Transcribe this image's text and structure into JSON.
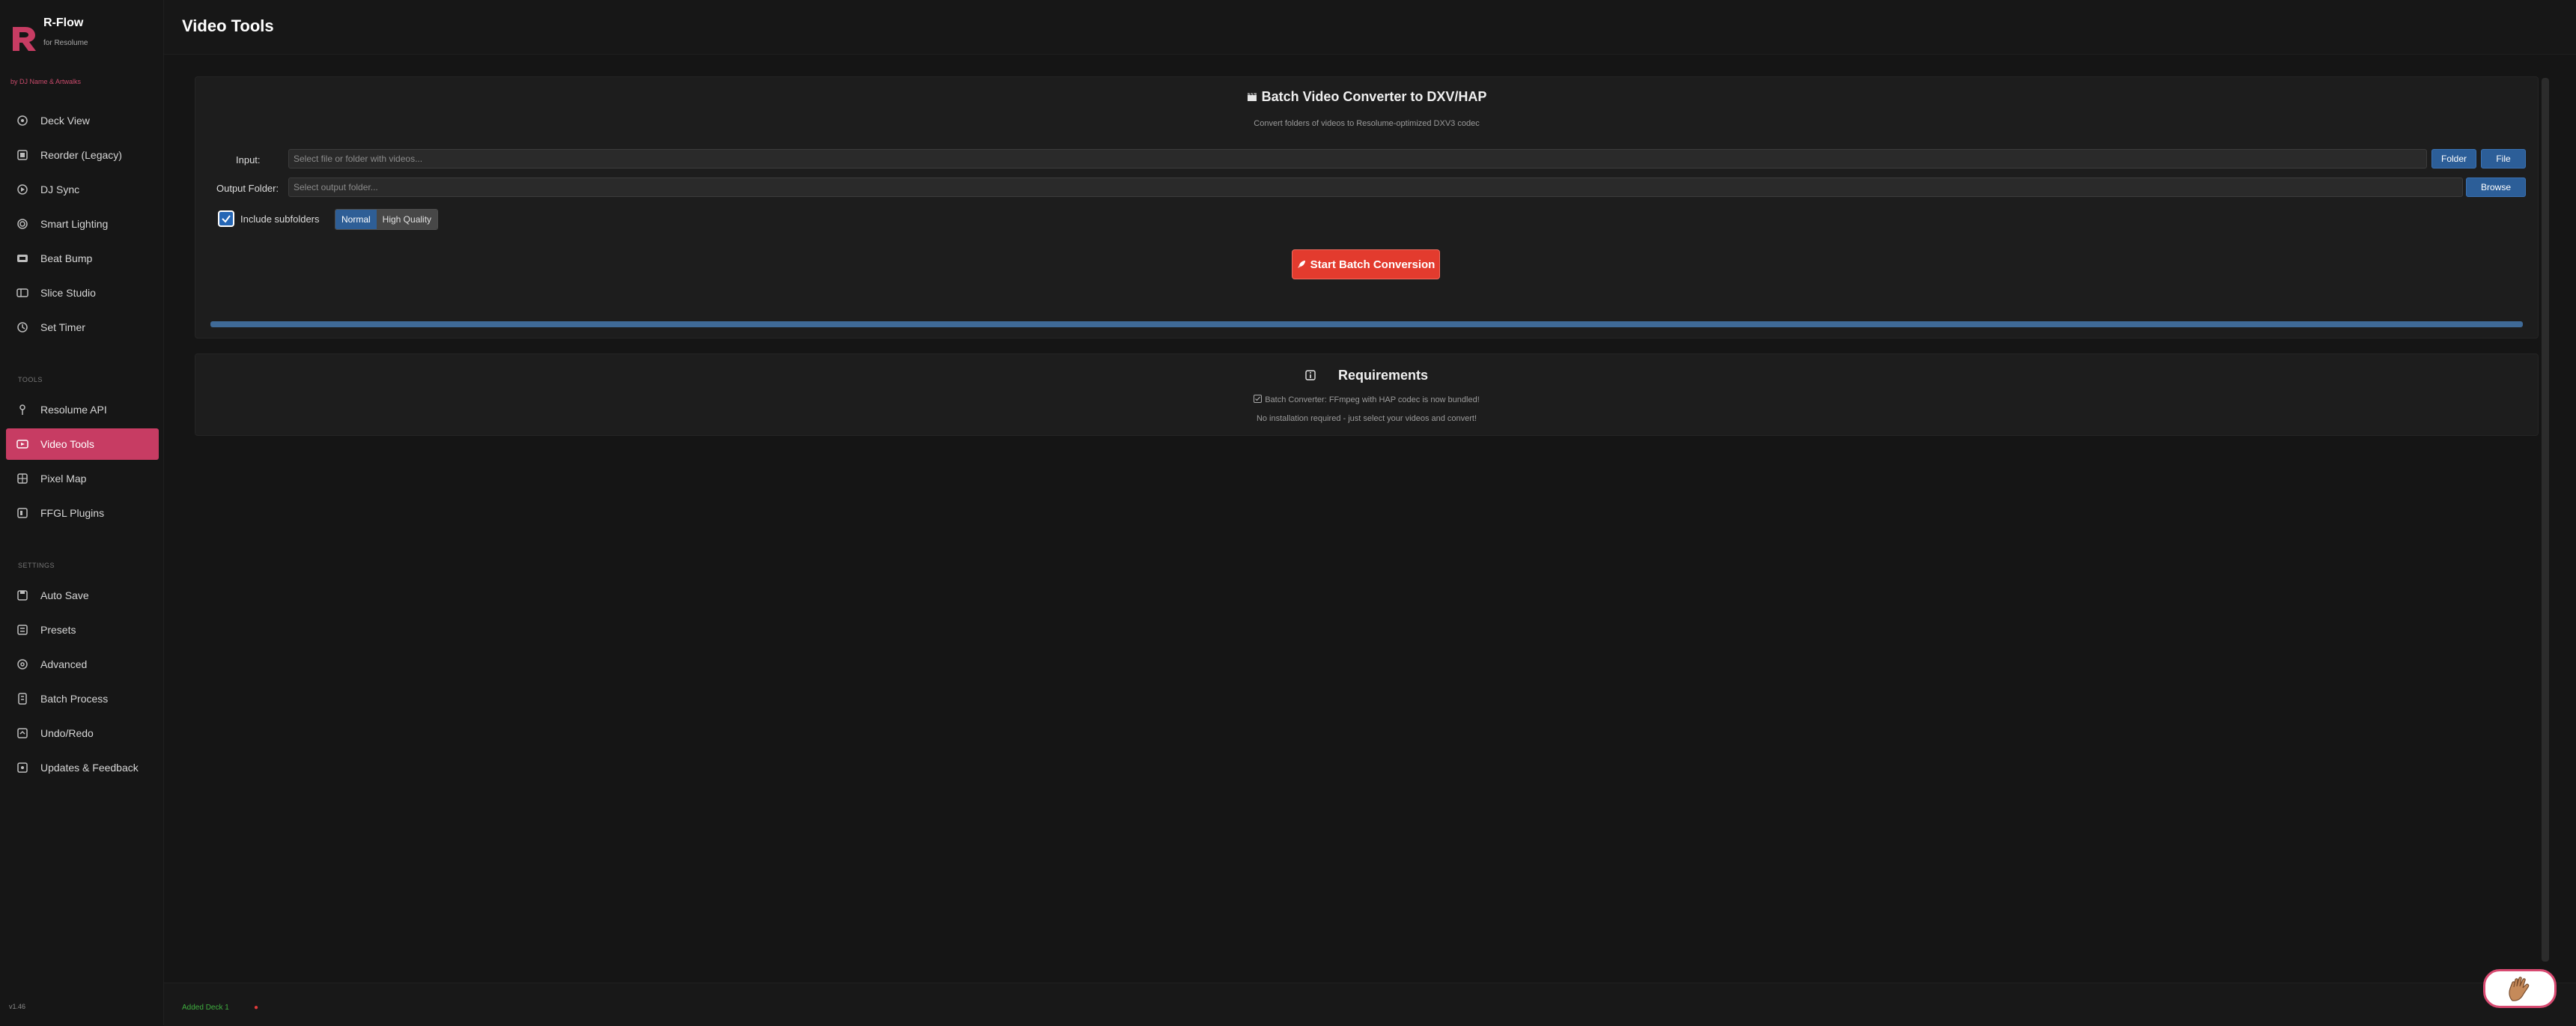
{
  "app": {
    "name": "R-Flow",
    "subtitle": "for Resolume",
    "by_line": "by DJ Name & Artwalks",
    "version": "v1.46",
    "accent_color": "#c73c63"
  },
  "sidebar": {
    "main_items": [
      {
        "label": "Deck View",
        "icon": "deck-icon"
      },
      {
        "label": "Reorder (Legacy)",
        "icon": "reorder-icon"
      },
      {
        "label": "DJ Sync",
        "icon": "sync-icon"
      },
      {
        "label": "Smart Lighting",
        "icon": "lighting-icon"
      },
      {
        "label": "Beat Bump",
        "icon": "beat-icon"
      },
      {
        "label": "Slice Studio",
        "icon": "slice-icon"
      },
      {
        "label": "Set Timer",
        "icon": "timer-icon"
      }
    ],
    "tools_label": "TOOLS",
    "tools_items": [
      {
        "label": "Resolume API",
        "icon": "api-icon"
      },
      {
        "label": "Video Tools",
        "icon": "video-icon",
        "active": true
      },
      {
        "label": "Pixel Map",
        "icon": "pixel-icon"
      },
      {
        "label": "FFGL Plugins",
        "icon": "plugin-icon"
      }
    ],
    "settings_label": "SETTINGS",
    "settings_items": [
      {
        "label": "Auto Save",
        "icon": "save-icon"
      },
      {
        "label": "Presets",
        "icon": "presets-icon"
      },
      {
        "label": "Advanced",
        "icon": "advanced-icon"
      },
      {
        "label": "Batch Process",
        "icon": "batch-icon"
      },
      {
        "label": "Undo/Redo",
        "icon": "undo-icon"
      },
      {
        "label": "Updates & Feedback",
        "icon": "feedback-icon"
      }
    ]
  },
  "header": {
    "title": "Video Tools"
  },
  "converter": {
    "title": "Batch Video Converter to DXV/HAP",
    "subtitle": "Convert folders of videos to Resolume-optimized DXV3 codec",
    "input_label": "Input:",
    "input_placeholder": "Select file or folder with videos...",
    "folder_button": "Folder",
    "file_button": "File",
    "output_label": "Output Folder:",
    "output_placeholder": "Select output folder...",
    "browse_button": "Browse",
    "include_subfolders_label": "Include subfolders",
    "include_subfolders_checked": true,
    "quality_options": [
      "Normal",
      "High Quality"
    ],
    "quality_selected": "Normal",
    "start_button": "Start Batch Conversion",
    "progress": 1.0
  },
  "requirements": {
    "title": "Requirements",
    "line1": "Batch Converter: FFmpeg with HAP codec is now bundled!",
    "line2": "No installation required - just select your videos and convert!"
  },
  "footer": {
    "status": "Added Deck 1",
    "dot": "●"
  }
}
